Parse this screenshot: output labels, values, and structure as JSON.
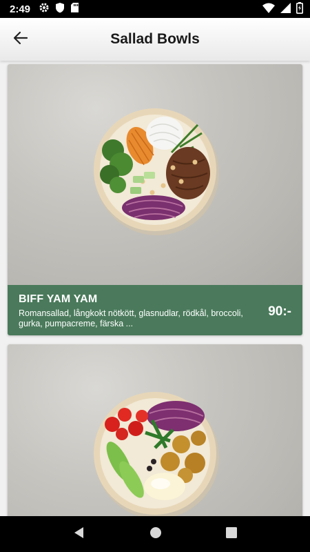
{
  "status_bar": {
    "time": "2:49",
    "icons": [
      "settings-gear-icon",
      "shield-icon",
      "sd-card-icon",
      "wifi-icon",
      "signal-icon",
      "battery-charging-icon"
    ]
  },
  "app_bar": {
    "title": "Sallad Bowls",
    "back_icon": "arrow-left-icon"
  },
  "items": [
    {
      "name": "BIFF YAM YAM",
      "description": "Romansallad, långkokt nötkött, glasnudlar, rödkål, broccoli, gurka, pumpacreme, färska ...",
      "price": "90:-",
      "image": "beef-salad-bowl"
    },
    {
      "name": "",
      "description": "",
      "price": "",
      "image": "falafel-salad-bowl"
    }
  ],
  "nav_bar": {
    "buttons": [
      "back-triangle-icon",
      "home-circle-icon",
      "recents-square-icon"
    ]
  },
  "colors": {
    "card_footer": "#4a7a5b",
    "status_bar": "#000000",
    "nav_bar": "#000000"
  }
}
